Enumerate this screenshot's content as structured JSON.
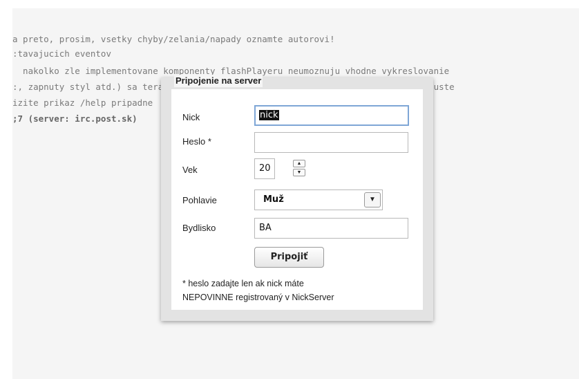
{
  "console": {
    "lines": [
      {
        "text": "a preto, prosim, vsetky chyby/zelania/napady oznamte autorovi!",
        "bold": false
      },
      {
        "text": ":tavajucich eventov",
        "bold": false
      },
      {
        "text": "  nakolko zle implementovane komponenty flashPlayeru neumoznuju vhodne vykreslovanie",
        "bold": false
      },
      {
        "text": ":, zapnuty styl atd.) sa teraz ukladaju na hardDisk a obnovia sa pri opatovnom spuste",
        "bold": false
      },
      {
        "text": "izite prikaz /help pripadne                                blizsie spoznat",
        "bold": false
      },
      {
        "text": ";7 (server: irc.post.sk)                                43, kvoli internej komun",
        "bold": true
      }
    ]
  },
  "dialog": {
    "title": "Pripojenie na server",
    "nick_label": "Nick",
    "nick_value": "nick",
    "password_label": "Heslo *",
    "password_value": "",
    "age_label": "Vek",
    "age_value": "20",
    "gender_label": "Pohlavie",
    "gender_value": "Muž",
    "residence_label": "Bydlisko",
    "residence_value": "BA",
    "connect_label": "Pripojiť",
    "note_line1": "* heslo zadajte len ak nick máte",
    "note_line2": "NEPOVINNE registrovaný v NickServer"
  },
  "icons": {
    "step_up": "up-arrow-icon",
    "step_down": "down-arrow-icon",
    "dropdown": "chevron-down-icon"
  }
}
